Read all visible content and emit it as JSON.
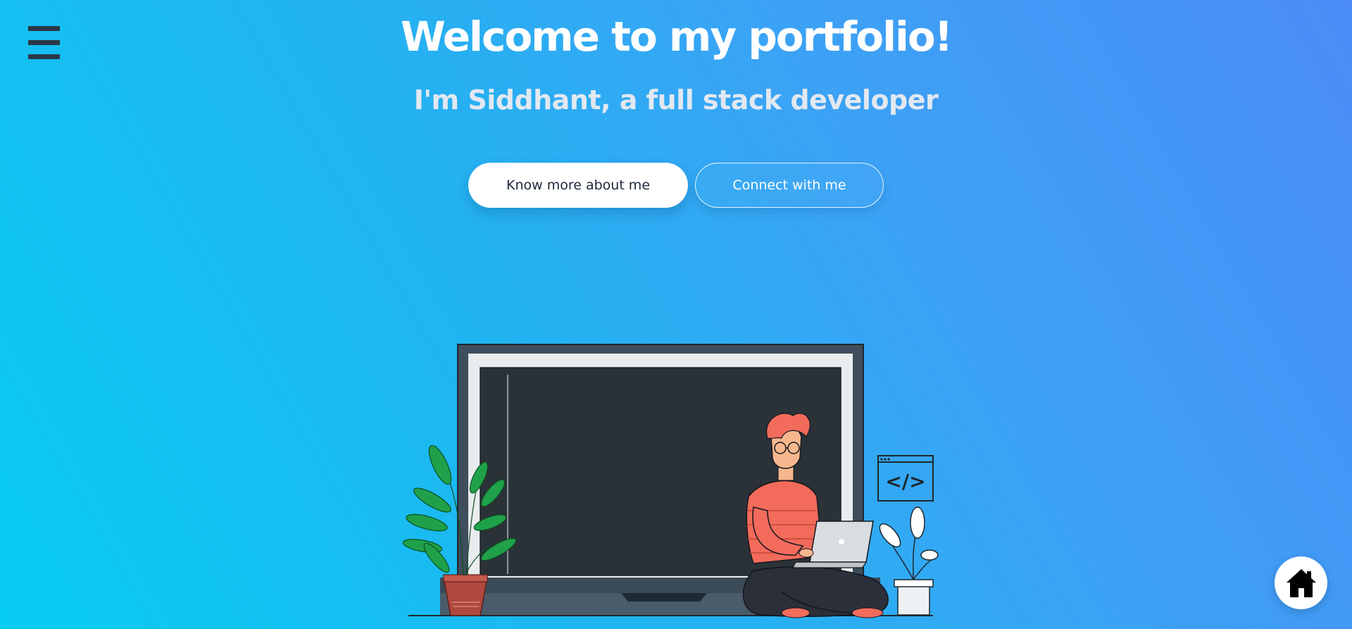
{
  "header": {
    "menu_icon": "hamburger-menu-icon"
  },
  "hero": {
    "title": "Welcome to my portfolio!",
    "subtitle": "I'm Siddhant, a full stack developer",
    "primary_button": "Know more about me",
    "secondary_button": "Connect with me"
  },
  "illustration": {
    "icon": "developer-with-laptop-illustration",
    "code_glyph": "</>"
  },
  "home_button": {
    "icon": "home-icon"
  },
  "colors": {
    "gradient_start": "#07cdf2",
    "gradient_end": "#4b8cf6",
    "menu_bar": "#2b3746",
    "screen_dark": "#2a3238",
    "shirt": "#f26b5b"
  }
}
